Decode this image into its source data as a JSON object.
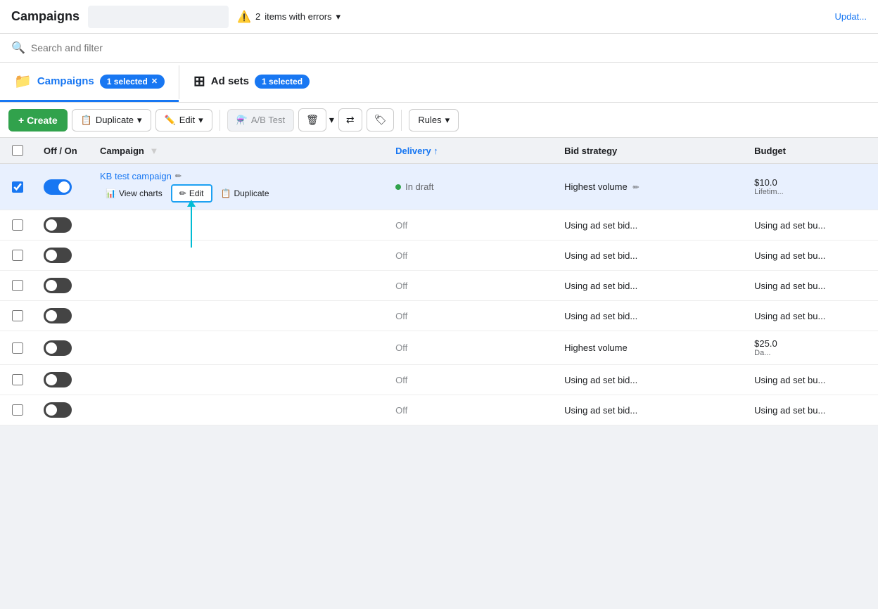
{
  "topbar": {
    "title": "Campaigns",
    "error_count": "2",
    "error_label": "items with errors",
    "update_label": "Updat..."
  },
  "search": {
    "placeholder": "Search and filter"
  },
  "tabs": [
    {
      "id": "campaigns",
      "label": "Campaigns",
      "icon": "📁",
      "active": true,
      "selected_count": "1 selected"
    },
    {
      "id": "adsets",
      "label": "Ad sets",
      "icon": "⊞",
      "active": false,
      "selected_count": "1 selected"
    }
  ],
  "toolbar": {
    "create_label": "+ Create",
    "duplicate_label": "Duplicate",
    "edit_label": "Edit",
    "ab_test_label": "A/B Test",
    "rules_label": "Rules"
  },
  "table": {
    "columns": [
      {
        "id": "off_on",
        "label": "Off / On"
      },
      {
        "id": "campaign",
        "label": "Campaign"
      },
      {
        "id": "delivery",
        "label": "Delivery ↑",
        "sort": true
      },
      {
        "id": "bid_strategy",
        "label": "Bid strategy"
      },
      {
        "id": "budget",
        "label": "Budget"
      }
    ],
    "rows": [
      {
        "id": 1,
        "selected": true,
        "toggle": true,
        "campaign_name": "KB test campaign",
        "has_pencil": true,
        "show_actions": true,
        "delivery": "In draft",
        "delivery_status": "draft",
        "bid_strategy": "Highest volume",
        "budget": "$10.0",
        "budget_sub": "Lifetim..."
      },
      {
        "id": 2,
        "selected": false,
        "toggle": false,
        "campaign_name": "",
        "delivery": "Off",
        "bid_strategy": "Using ad set bid...",
        "budget": "Using ad set bu..."
      },
      {
        "id": 3,
        "selected": false,
        "toggle": false,
        "campaign_name": "",
        "delivery": "Off",
        "bid_strategy": "Using ad set bid...",
        "budget": "Using ad set bu..."
      },
      {
        "id": 4,
        "selected": false,
        "toggle": false,
        "campaign_name": "",
        "delivery": "Off",
        "bid_strategy": "Using ad set bid...",
        "budget": "Using ad set bu..."
      },
      {
        "id": 5,
        "selected": false,
        "toggle": false,
        "campaign_name": "",
        "delivery": "Off",
        "bid_strategy": "Using ad set bid...",
        "budget": "Using ad set bu..."
      },
      {
        "id": 6,
        "selected": false,
        "toggle": false,
        "campaign_name": "",
        "delivery": "Off",
        "bid_strategy": "Highest volume",
        "budget": "$25.0",
        "budget_sub": "Da..."
      },
      {
        "id": 7,
        "selected": false,
        "toggle": false,
        "campaign_name": "",
        "delivery": "Off",
        "bid_strategy": "Using ad set bid...",
        "budget": "Using ad set bu..."
      },
      {
        "id": 8,
        "selected": false,
        "toggle": false,
        "campaign_name": "",
        "delivery": "Off",
        "bid_strategy": "Using ad set bid...",
        "budget": "Using ad set bu..."
      }
    ],
    "inline_actions": {
      "view_charts": "View charts",
      "edit": "Edit",
      "duplicate": "Duplicate"
    }
  }
}
